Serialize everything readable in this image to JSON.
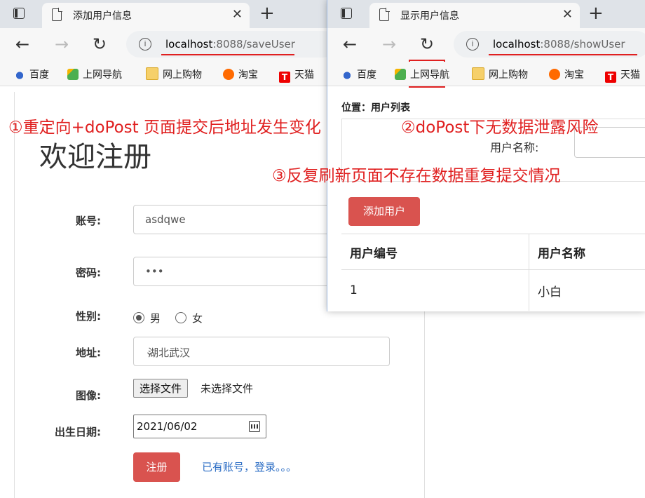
{
  "left_window": {
    "tab_title": "添加用户信息",
    "tab_close": "✕",
    "new_tab": "+",
    "url_host": "localhost",
    "url_rest": ":8088/saveUser",
    "nav": {
      "back": "←",
      "forward": "→",
      "reload": "↻",
      "info": "i"
    },
    "bookmarks": [
      "百度",
      "上网导航",
      "网上购物",
      "淘宝",
      "天猫"
    ],
    "form": {
      "heading": "欢迎注册",
      "account_label": "账号:",
      "account_value": "asdqwe",
      "password_label": "密码:",
      "password_value": "•••",
      "gender_label": "性别:",
      "gender_options": [
        "男",
        "女"
      ],
      "gender_selected": "男",
      "address_label": "地址:",
      "address_value": "湖北武汉",
      "image_label": "图像:",
      "file_button": "选择文件",
      "file_status": "未选择文件",
      "birth_label": "出生日期:",
      "birth_value": "2021/06/02",
      "submit_button": "注册",
      "login_link": "已有账号，登录。。。"
    }
  },
  "right_window": {
    "tab_title": "显示用户信息",
    "tab_close": "✕",
    "new_tab": "+",
    "url_host": "localhost",
    "url_rest": ":8088/showUser",
    "nav": {
      "back": "←",
      "forward": "→",
      "reload": "↻",
      "info": "i"
    },
    "bookmarks": [
      "百度",
      "上网导航",
      "网上购物",
      "淘宝",
      "天猫"
    ],
    "breadcrumb": "位置：用户列表",
    "search_label": "用户名称:",
    "add_button": "添加用户",
    "table": {
      "headers": [
        "用户编号",
        "用户名称"
      ],
      "rows": [
        [
          "1",
          "小白"
        ]
      ]
    }
  },
  "annotations": {
    "a1": "①重定向+doPost 页面提交后地址发生变化",
    "a2": "②doPost下无数据泄露风险",
    "a3": "③反复刷新页面不存在数据重复提交情况"
  },
  "colors": {
    "annotation": "#e02020",
    "button": "#d9534f",
    "link": "#2a6cc4"
  }
}
